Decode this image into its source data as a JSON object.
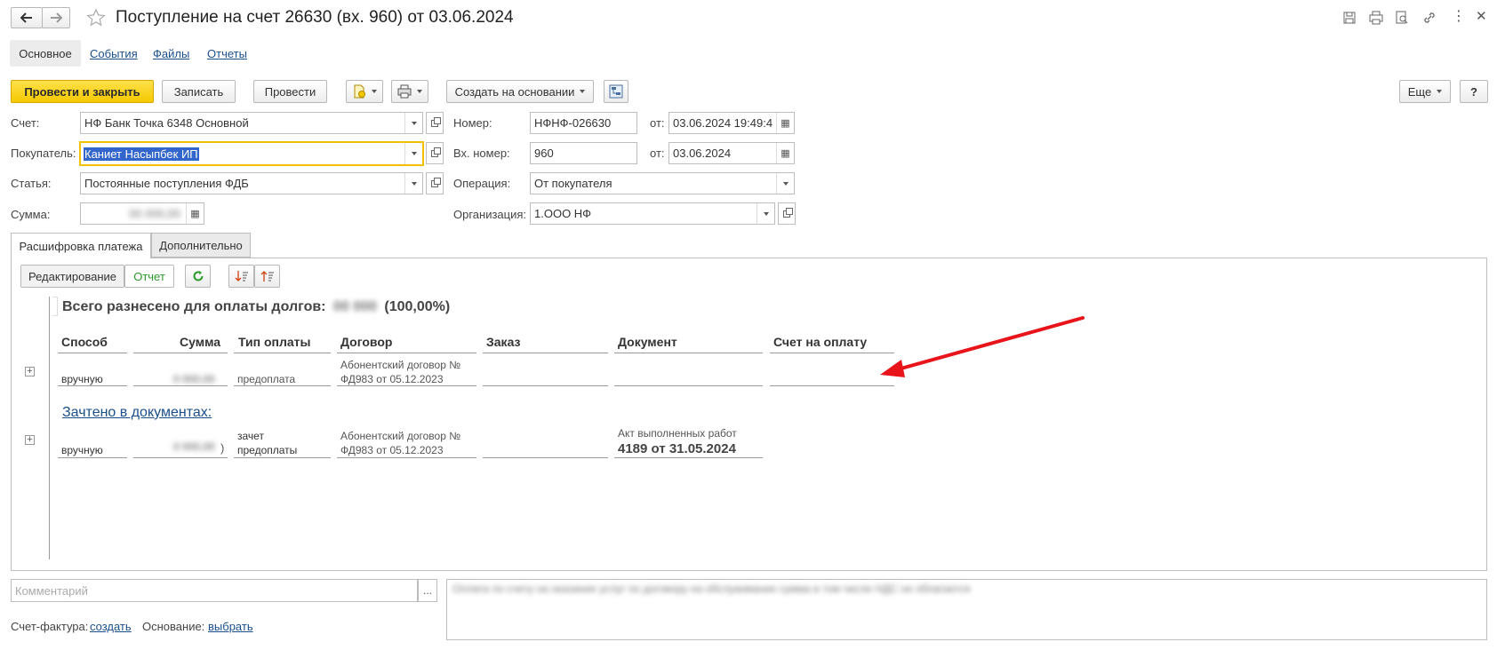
{
  "window": {
    "title": "Поступление на счет 26630 (вх. 960) от 03.06.2024",
    "back_icon": "arrow-left",
    "forward_icon": "arrow-right",
    "star_icon": "star-outline",
    "actions": [
      "save-icon",
      "print-icon",
      "preview-icon",
      "link-icon",
      "more-icon",
      "close-icon"
    ]
  },
  "tabs": [
    "Основное",
    "События",
    "Файлы",
    "Отчеты"
  ],
  "toolbar": {
    "post_and_close": "Провести и закрыть",
    "save": "Записать",
    "post": "Провести",
    "create_based_on": "Создать на основании",
    "more": "Еще",
    "help": "?"
  },
  "form": {
    "account_label": "Счет:",
    "account_value": "НФ Банк Точка 6348 Основной",
    "buyer_label": "Покупатель:",
    "buyer_value": "Каниет Насыпбек ИП",
    "article_label": "Статья:",
    "article_value": "Постоянные поступления ФДБ",
    "sum_label": "Сумма:",
    "sum_value": "00 000,00",
    "number_label": "Номер:",
    "number_value": "НФНФ-026630",
    "from_label": "от:",
    "number_date": "03.06.2024 19:49:4",
    "in_number_label": "Вх. номер:",
    "in_number_value": "960",
    "in_number_date": "03.06.2024",
    "operation_label": "Операция:",
    "operation_value": "От покупателя",
    "org_label": "Организация:",
    "org_value": "1.ООО НФ"
  },
  "inner_tabs": [
    "Расшифровка платежа",
    "Дополнительно"
  ],
  "panel": {
    "mode_edit": "Редактирование",
    "mode_report": "Отчет",
    "summary_prefix": "Всего разнесено для оплаты долгов:",
    "summary_amount": "00 000",
    "summary_percent": "(100,00%)",
    "columns": [
      "Способ",
      "Сумма",
      "Тип оплаты",
      "Договор",
      "Заказ",
      "Документ",
      "Счет на оплату"
    ],
    "row1": {
      "method": "вручную",
      "sum": "0 000,00",
      "type": "предоплата",
      "contract_line1": "Абонентский договор №",
      "contract_line2": "ФД983 от 05.12.2023"
    },
    "offset_link": "Зачтено в документах:",
    "row2": {
      "method": "вручную",
      "sum": "0 000,00",
      "sum_suffix": ")",
      "type_line1": "зачет",
      "type_line2": "предоплаты",
      "contract_line1": "Абонентский договор №",
      "contract_line2": "ФД983 от 05.12.2023",
      "doc_line1": "Акт выполненных работ",
      "doc_line2": "4189 от 31.05.2024"
    }
  },
  "bottom": {
    "comment_placeholder": "Комментарий",
    "comment_ellipsis": "...",
    "payment_purpose": "Оплата по счету на оказание услуг по договору на обслуживание сумма в том числе НДС не облагается",
    "invoice_label": "Счет-фактура:",
    "invoice_link": "создать",
    "basis_label": "Основание:",
    "basis_link": "выбрать"
  },
  "colors": {
    "accent_yellow": "#f5c800",
    "link": "#1a4f8b",
    "arrow": "#e8141a",
    "report_green": "#2a9a2a"
  }
}
